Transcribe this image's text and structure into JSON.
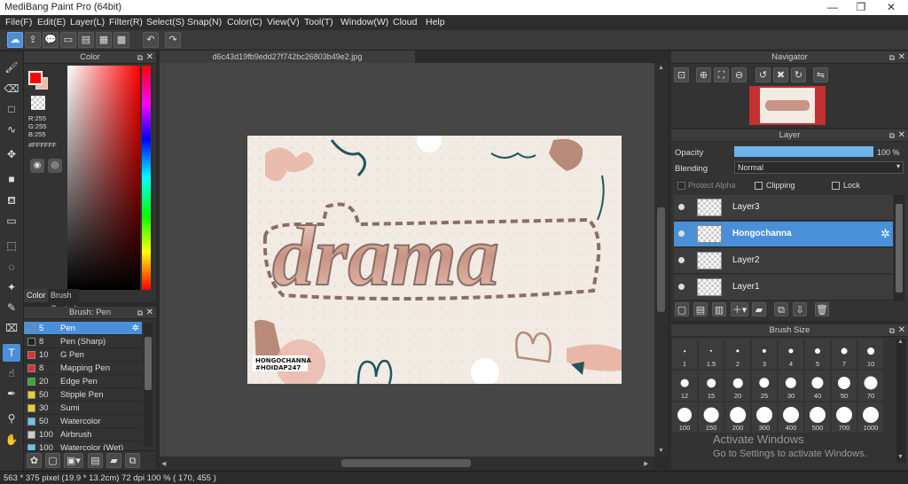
{
  "window": {
    "title": "MediBang Paint Pro (64bit)",
    "minimize": "—",
    "restore": "❐",
    "close": "✕"
  },
  "menu": [
    "File(F)",
    "Edit(E)",
    "Layer(L)",
    "Filter(R)",
    "Select(S)",
    "Snap(N)",
    "Color(C)",
    "View(V)",
    "Tool(T)",
    "Window(W)",
    "Cloud",
    "Help"
  ],
  "colorPanel": {
    "title": "Color",
    "r": "R:255",
    "g": "G:255",
    "b": "B:255",
    "hex": "#FFFFFF",
    "tabColor": "Color",
    "tabBrush": "Brush Control",
    "fg": "#ff0000",
    "bg": "#f4b99a"
  },
  "brushPanel": {
    "title": "Brush: Pen",
    "items": [
      {
        "size": "5",
        "name": "Pen",
        "color": "#4a90d9"
      },
      {
        "size": "8",
        "name": "Pen (Sharp)",
        "color": "#222222"
      },
      {
        "size": "10",
        "name": "G Pen",
        "color": "#e03030"
      },
      {
        "size": "8",
        "name": "Mapping Pen",
        "color": "#e03030"
      },
      {
        "size": "20",
        "name": "Edge Pen",
        "color": "#30b030"
      },
      {
        "size": "50",
        "name": "Stipple Pen",
        "color": "#e8d020"
      },
      {
        "size": "30",
        "name": "Sumi",
        "color": "#e8d020"
      },
      {
        "size": "50",
        "name": "Watercolor",
        "color": "#60c8f0"
      },
      {
        "size": "100",
        "name": "Airbrush",
        "color": "#cccccc"
      },
      {
        "size": "100",
        "name": "Watercolor (Wet)",
        "color": "#60c8f0"
      }
    ]
  },
  "canvas": {
    "tab": "d6c43d19fb9edd27f742bc26803b49e2.jpg",
    "artText": "drama",
    "caption1": "HONGOCHANNA",
    "caption2": "#HOIDAP247"
  },
  "navigator": {
    "title": "Navigator"
  },
  "layerPanel": {
    "title": "Layer",
    "opacityLabel": "Opacity",
    "opacityValue": "100 %",
    "opacity": 100,
    "blendingLabel": "Blending",
    "blendingValue": "Normal",
    "protectAlpha": "Protect Alpha",
    "clipping": "Clipping",
    "lock": "Lock",
    "layers": [
      {
        "name": "Layer3",
        "selected": false
      },
      {
        "name": "Hongochanna",
        "selected": true
      },
      {
        "name": "Layer2",
        "selected": false
      },
      {
        "name": "Layer1",
        "selected": false
      }
    ]
  },
  "brushSize": {
    "title": "Brush Size",
    "sizes": [
      "1",
      "1.5",
      "2",
      "3",
      "4",
      "5",
      "7",
      "10",
      "12",
      "15",
      "20",
      "25",
      "30",
      "40",
      "50",
      "70",
      "100",
      "150",
      "200",
      "300",
      "400",
      "500",
      "700",
      "1000"
    ]
  },
  "watermark": {
    "line1": "Activate Windows",
    "line2": "Go to Settings to activate Windows."
  },
  "status": "563 * 375 pixel   (19.9 * 13.2cm)   72 dpi   100 %   ( 170, 455 )"
}
